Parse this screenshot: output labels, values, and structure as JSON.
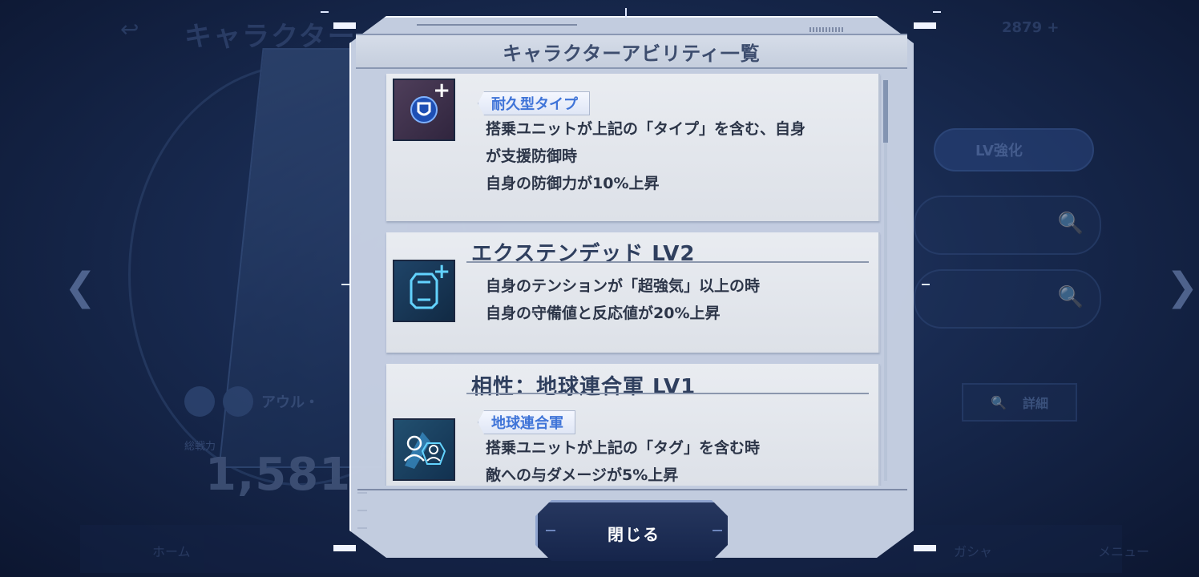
{
  "background": {
    "title": "キャラクター",
    "character_name": "アウル・",
    "power_label": "総戦力",
    "power_value": "1,581",
    "lv_button": "LV強化",
    "detail_button": "詳細",
    "nav_home": "ホーム",
    "nav_gacha": "ガシャ",
    "nav_menu": "メニュー",
    "top_right": "2879 +"
  },
  "modal": {
    "title": "キャラクターアビリティ一覧",
    "close_label": "閉じる",
    "abilities": [
      {
        "icon": "shield-plus-icon",
        "title": "",
        "tag": "耐久型タイプ",
        "description": "搭乗ユニットが上記の「タイプ」を含む、自身\nが支援防御時\n自身の防御力が10%上昇"
      },
      {
        "icon": "armor-plus-icon",
        "title": "エクステンデッド LV2",
        "tag": "",
        "description": "自身のテンションが「超強気」以上の時\n自身の守備値と反応値が20%上昇"
      },
      {
        "icon": "pilot-affinity-icon",
        "title": "相性：地球連合軍 LV1",
        "tag": "地球連合軍",
        "description": "搭乗ユニットが上記の「タグ」を含む時\n敵への与ダメージが5%上昇"
      }
    ]
  }
}
